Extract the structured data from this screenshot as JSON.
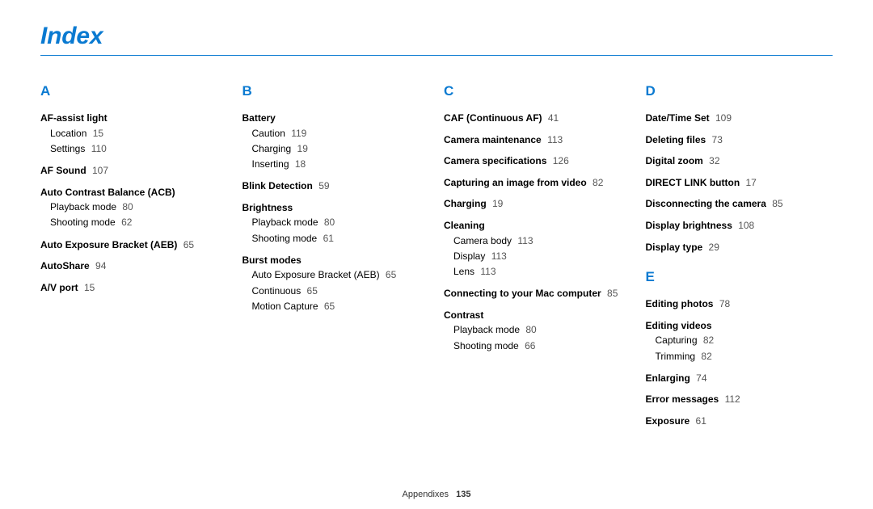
{
  "title": "Index",
  "footer": {
    "section": "Appendixes",
    "page": "135"
  },
  "columns": [
    {
      "sections": [
        {
          "letter": "A",
          "entries": [
            {
              "label": "AF-assist light",
              "subs": [
                {
                  "label": "Location",
                  "page": "15"
                },
                {
                  "label": "Settings",
                  "page": "110"
                }
              ]
            },
            {
              "label": "AF Sound",
              "page": "107"
            },
            {
              "label": "Auto Contrast Balance (ACB)",
              "subs": [
                {
                  "label": "Playback mode",
                  "page": "80"
                },
                {
                  "label": "Shooting mode",
                  "page": "62"
                }
              ]
            },
            {
              "label": "Auto Exposure Bracket (AEB)",
              "page": "65"
            },
            {
              "label": "AutoShare",
              "page": "94"
            },
            {
              "label": "A/V port",
              "page": "15"
            }
          ]
        }
      ]
    },
    {
      "sections": [
        {
          "letter": "B",
          "entries": [
            {
              "label": "Battery",
              "subs": [
                {
                  "label": "Caution",
                  "page": "119"
                },
                {
                  "label": "Charging",
                  "page": "19"
                },
                {
                  "label": "Inserting",
                  "page": "18"
                }
              ]
            },
            {
              "label": "Blink Detection",
              "page": "59"
            },
            {
              "label": "Brightness",
              "subs": [
                {
                  "label": "Playback mode",
                  "page": "80"
                },
                {
                  "label": "Shooting mode",
                  "page": "61"
                }
              ]
            },
            {
              "label": "Burst modes",
              "subs": [
                {
                  "label": "Auto Exposure Bracket (AEB)",
                  "page": "65"
                },
                {
                  "label": "Continuous",
                  "page": "65"
                },
                {
                  "label": "Motion Capture",
                  "page": "65"
                }
              ]
            }
          ]
        }
      ]
    },
    {
      "sections": [
        {
          "letter": "C",
          "entries": [
            {
              "label": "CAF (Continuous AF)",
              "page": "41"
            },
            {
              "label": "Camera maintenance",
              "page": "113"
            },
            {
              "label": "Camera specifications",
              "page": "126"
            },
            {
              "label": "Capturing an image from video",
              "page": "82"
            },
            {
              "label": "Charging",
              "page": "19"
            },
            {
              "label": "Cleaning",
              "subs": [
                {
                  "label": "Camera body",
                  "page": "113"
                },
                {
                  "label": "Display",
                  "page": "113"
                },
                {
                  "label": "Lens",
                  "page": "113"
                }
              ]
            },
            {
              "label": "Connecting to your Mac computer",
              "page": "85"
            },
            {
              "label": "Contrast",
              "subs": [
                {
                  "label": "Playback mode",
                  "page": "80"
                },
                {
                  "label": "Shooting mode",
                  "page": "66"
                }
              ]
            }
          ]
        }
      ]
    },
    {
      "sections": [
        {
          "letter": "D",
          "entries": [
            {
              "label": "Date/Time Set",
              "page": "109"
            },
            {
              "label": "Deleting files",
              "page": "73"
            },
            {
              "label": "Digital zoom",
              "page": "32"
            },
            {
              "label": "DIRECT LINK button",
              "page": "17"
            },
            {
              "label": "Disconnecting the camera",
              "page": "85"
            },
            {
              "label": "Display brightness",
              "page": "108"
            },
            {
              "label": "Display type",
              "page": "29"
            }
          ]
        },
        {
          "letter": "E",
          "entries": [
            {
              "label": "Editing photos",
              "page": "78"
            },
            {
              "label": "Editing videos",
              "subs": [
                {
                  "label": "Capturing",
                  "page": "82"
                },
                {
                  "label": "Trimming",
                  "page": "82"
                }
              ]
            },
            {
              "label": "Enlarging",
              "page": "74"
            },
            {
              "label": "Error messages",
              "page": "112"
            },
            {
              "label": "Exposure",
              "page": "61"
            }
          ]
        }
      ]
    }
  ]
}
